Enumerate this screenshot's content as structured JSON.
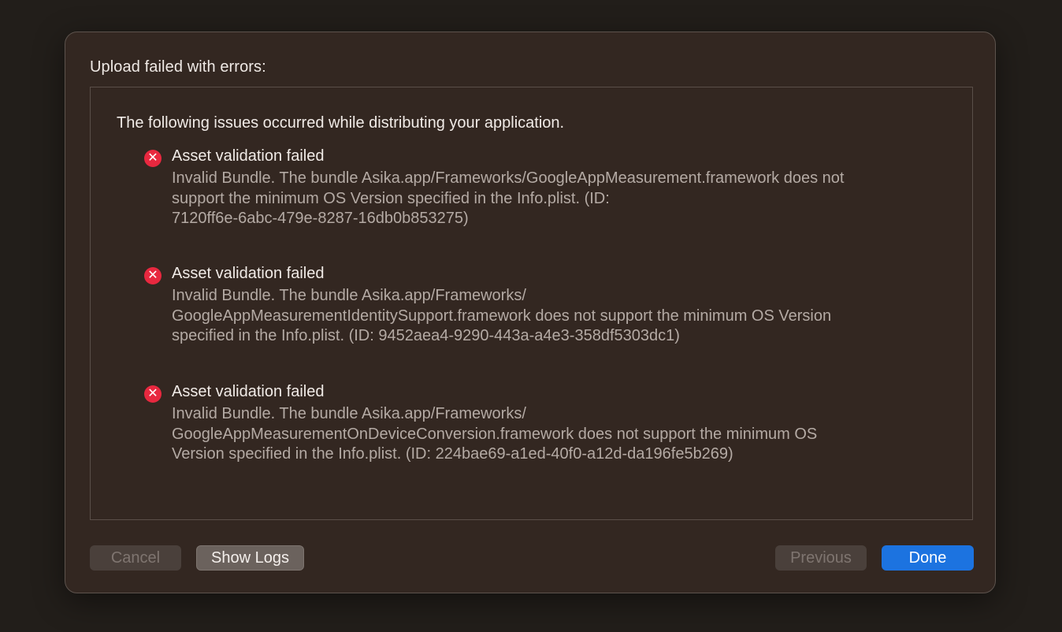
{
  "dialog": {
    "title": "Upload failed with errors:"
  },
  "panel": {
    "intro": "The following issues occurred while distributing your application.",
    "issues": [
      {
        "icon": "error-icon",
        "icon_glyph": "✕",
        "title": "Asset validation failed",
        "lines": [
          "Invalid Bundle. The bundle Asika.app/Frameworks/GoogleAppMeasurement.framework does not",
          "support the minimum OS Version specified in the Info.plist. (ID:",
          "7120ff6e-6abc-479e-8287-16db0b853275)"
        ]
      },
      {
        "icon": "error-icon",
        "icon_glyph": "✕",
        "title": "Asset validation failed",
        "lines": [
          "Invalid Bundle. The bundle Asika.app/Frameworks/",
          "GoogleAppMeasurementIdentitySupport.framework does not support the minimum OS Version",
          "specified in the Info.plist. (ID: 9452aea4-9290-443a-a4e3-358df5303dc1)"
        ]
      },
      {
        "icon": "error-icon",
        "icon_glyph": "✕",
        "title": "Asset validation failed",
        "lines": [
          "Invalid Bundle. The bundle Asika.app/Frameworks/",
          "GoogleAppMeasurementOnDeviceConversion.framework does not support the minimum OS",
          "Version specified in the Info.plist. (ID: 224bae69-a1ed-40f0-a12d-da196fe5b269)"
        ]
      }
    ]
  },
  "buttons": {
    "cancel": "Cancel",
    "show_logs": "Show Logs",
    "previous": "Previous",
    "done": "Done"
  },
  "colors": {
    "error": "#e8283f",
    "primary": "#1c73e0"
  }
}
